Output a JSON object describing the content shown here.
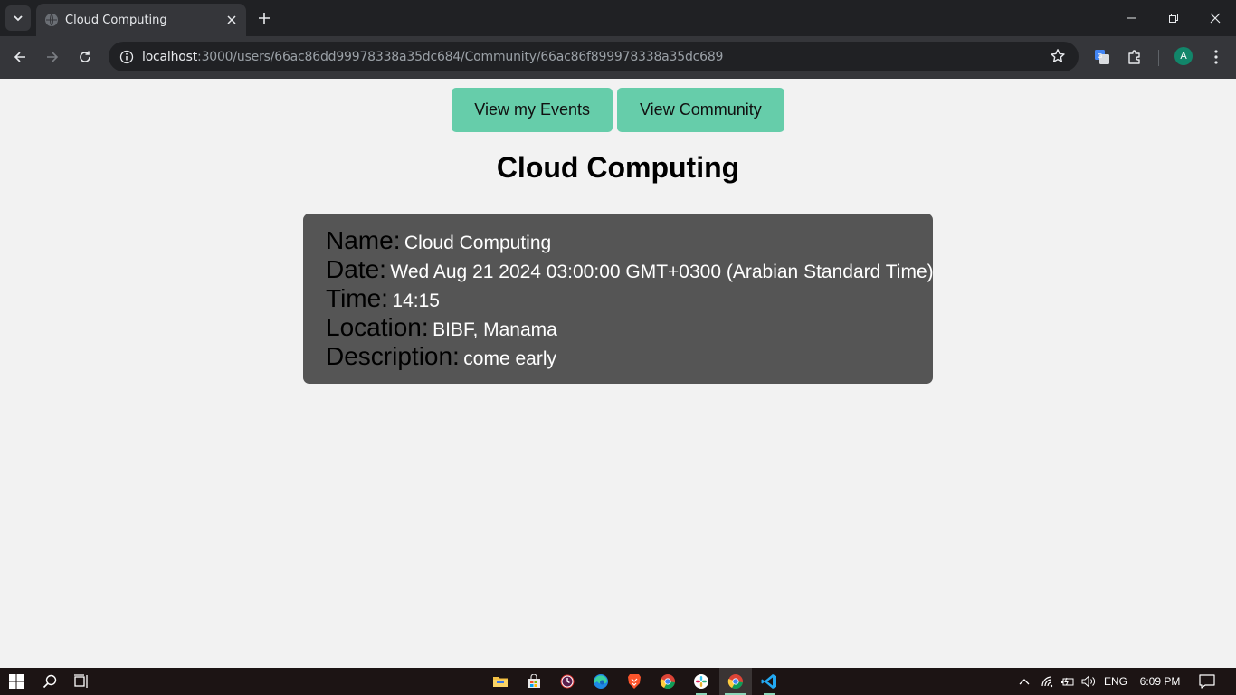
{
  "browser": {
    "tab_title": "Cloud Computing",
    "url_host": "localhost",
    "url_rest": ":3000/users/66ac86dd99978338a35dc684/Community/66ac86f899978338a35dc689",
    "profile_initial": "A"
  },
  "page": {
    "nav": {
      "events_label": "View my Events",
      "community_label": "View Community"
    },
    "title": "Cloud Computing",
    "details": {
      "name_label": "Name:",
      "name_value": "Cloud Computing",
      "date_label": "Date:",
      "date_value": "Wed Aug 21 2024 03:00:00 GMT+0300 (Arabian Standard Time)",
      "time_label": "Time:",
      "time_value": "14:15",
      "location_label": "Location:",
      "location_value": "BIBF, Manama",
      "description_label": "Description:",
      "description_value": "come early"
    }
  },
  "taskbar": {
    "language": "ENG",
    "clock": "6:09 PM"
  },
  "colors": {
    "button_green": "#66cdaa",
    "card_bg": "#555555",
    "page_bg": "#f2f2f2"
  }
}
